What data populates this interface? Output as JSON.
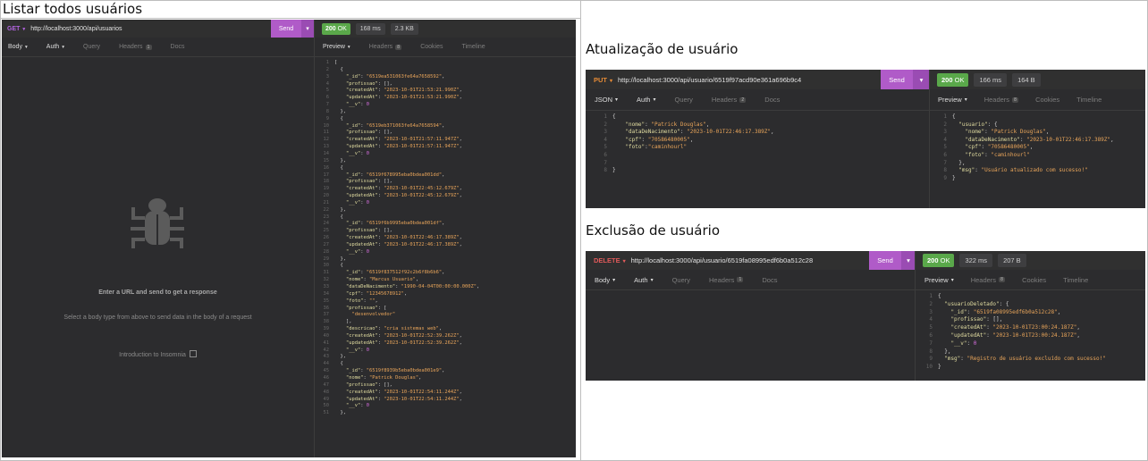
{
  "section_titles": {
    "list": "Listar todos usuários",
    "update": "Atualização de usuário",
    "delete": "Exclusão de usuário"
  },
  "list_panel": {
    "method": "GET",
    "url": "http://localhost:3000/api/usuarios",
    "send_label": "Send",
    "status_code": "200",
    "status_text": "OK",
    "time": "168 ms",
    "size": "2.3 KB",
    "request_tabs": [
      {
        "label": "Body",
        "caret": true,
        "active": true
      },
      {
        "label": "Auth",
        "caret": true,
        "active": false
      },
      {
        "label": "Query",
        "caret": false,
        "active": false
      },
      {
        "label": "Headers",
        "badge": "1",
        "active": false
      },
      {
        "label": "Docs",
        "active": false
      }
    ],
    "response_tabs": [
      {
        "label": "Preview",
        "caret": true,
        "active": true
      },
      {
        "label": "Headers",
        "badge": "8",
        "active": false
      },
      {
        "label": "Cookies",
        "active": false
      },
      {
        "label": "Timeline",
        "active": false
      }
    ],
    "empty_title": "Enter a URL and send to get a response",
    "empty_subtitle": "Select a body type from above to send data in the body of a request",
    "empty_link": "Introduction to Insomnia",
    "response_lines": [
      [
        {
          "t": "[",
          "c": "p"
        }
      ],
      [
        {
          "t": "  {",
          "c": "p"
        }
      ],
      [
        {
          "t": "    \"_id\"",
          "c": "k"
        },
        {
          "t": ": ",
          "c": "p"
        },
        {
          "t": "\"6519ea531063fe64a7658592\"",
          "c": "s"
        },
        {
          "t": ",",
          "c": "p"
        }
      ],
      [
        {
          "t": "    \"profissao\"",
          "c": "k"
        },
        {
          "t": ": [],",
          "c": "p"
        }
      ],
      [
        {
          "t": "    \"createdAt\"",
          "c": "k"
        },
        {
          "t": ": ",
          "c": "p"
        },
        {
          "t": "\"2023-10-01T21:53:21.990Z\"",
          "c": "s"
        },
        {
          "t": ",",
          "c": "p"
        }
      ],
      [
        {
          "t": "    \"updatedAt\"",
          "c": "k"
        },
        {
          "t": ": ",
          "c": "p"
        },
        {
          "t": "\"2023-10-01T21:53:21.990Z\"",
          "c": "s"
        },
        {
          "t": ",",
          "c": "p"
        }
      ],
      [
        {
          "t": "    \"__v\"",
          "c": "k"
        },
        {
          "t": ": ",
          "c": "p"
        },
        {
          "t": "0",
          "c": "n"
        }
      ],
      [
        {
          "t": "  },",
          "c": "p"
        }
      ],
      [
        {
          "t": "  {",
          "c": "p"
        }
      ],
      [
        {
          "t": "    \"_id\"",
          "c": "k"
        },
        {
          "t": ": ",
          "c": "p"
        },
        {
          "t": "\"6519eb371063fe64a7658594\"",
          "c": "s"
        },
        {
          "t": ",",
          "c": "p"
        }
      ],
      [
        {
          "t": "    \"profissao\"",
          "c": "k"
        },
        {
          "t": ": [],",
          "c": "p"
        }
      ],
      [
        {
          "t": "    \"createdAt\"",
          "c": "k"
        },
        {
          "t": ": ",
          "c": "p"
        },
        {
          "t": "\"2023-10-01T21:57:11.947Z\"",
          "c": "s"
        },
        {
          "t": ",",
          "c": "p"
        }
      ],
      [
        {
          "t": "    \"updatedAt\"",
          "c": "k"
        },
        {
          "t": ": ",
          "c": "p"
        },
        {
          "t": "\"2023-10-01T21:57:11.947Z\"",
          "c": "s"
        },
        {
          "t": ",",
          "c": "p"
        }
      ],
      [
        {
          "t": "    \"__v\"",
          "c": "k"
        },
        {
          "t": ": ",
          "c": "p"
        },
        {
          "t": "0",
          "c": "n"
        }
      ],
      [
        {
          "t": "  },",
          "c": "p"
        }
      ],
      [
        {
          "t": "  {",
          "c": "p"
        }
      ],
      [
        {
          "t": "    \"_id\"",
          "c": "k"
        },
        {
          "t": ": ",
          "c": "p"
        },
        {
          "t": "\"6519f678995eba0bdea001dd\"",
          "c": "s"
        },
        {
          "t": ",",
          "c": "p"
        }
      ],
      [
        {
          "t": "    \"profissao\"",
          "c": "k"
        },
        {
          "t": ": [],",
          "c": "p"
        }
      ],
      [
        {
          "t": "    \"createdAt\"",
          "c": "k"
        },
        {
          "t": ": ",
          "c": "p"
        },
        {
          "t": "\"2023-10-01T22:45:12.679Z\"",
          "c": "s"
        },
        {
          "t": ",",
          "c": "p"
        }
      ],
      [
        {
          "t": "    \"updatedAt\"",
          "c": "k"
        },
        {
          "t": ": ",
          "c": "p"
        },
        {
          "t": "\"2023-10-01T22:45:12.679Z\"",
          "c": "s"
        },
        {
          "t": ",",
          "c": "p"
        }
      ],
      [
        {
          "t": "    \"__v\"",
          "c": "k"
        },
        {
          "t": ": ",
          "c": "p"
        },
        {
          "t": "0",
          "c": "n"
        }
      ],
      [
        {
          "t": "  },",
          "c": "p"
        }
      ],
      [
        {
          "t": "  {",
          "c": "p"
        }
      ],
      [
        {
          "t": "    \"_id\"",
          "c": "k"
        },
        {
          "t": ": ",
          "c": "p"
        },
        {
          "t": "\"6519f6b9995eba0bdea001df\"",
          "c": "s"
        },
        {
          "t": ",",
          "c": "p"
        }
      ],
      [
        {
          "t": "    \"profissao\"",
          "c": "k"
        },
        {
          "t": ": [],",
          "c": "p"
        }
      ],
      [
        {
          "t": "    \"createdAt\"",
          "c": "k"
        },
        {
          "t": ": ",
          "c": "p"
        },
        {
          "t": "\"2023-10-01T22:46:17.389Z\"",
          "c": "s"
        },
        {
          "t": ",",
          "c": "p"
        }
      ],
      [
        {
          "t": "    \"updatedAt\"",
          "c": "k"
        },
        {
          "t": ": ",
          "c": "p"
        },
        {
          "t": "\"2023-10-01T22:46:17.389Z\"",
          "c": "s"
        },
        {
          "t": ",",
          "c": "p"
        }
      ],
      [
        {
          "t": "    \"__v\"",
          "c": "k"
        },
        {
          "t": ": ",
          "c": "p"
        },
        {
          "t": "0",
          "c": "n"
        }
      ],
      [
        {
          "t": "  },",
          "c": "p"
        }
      ],
      [
        {
          "t": "  {",
          "c": "p"
        }
      ],
      [
        {
          "t": "    \"_id\"",
          "c": "k"
        },
        {
          "t": ": ",
          "c": "p"
        },
        {
          "t": "\"6519f837512f92c2b6f8b6b6\"",
          "c": "s"
        },
        {
          "t": ",",
          "c": "p"
        }
      ],
      [
        {
          "t": "    \"nome\"",
          "c": "k"
        },
        {
          "t": ": ",
          "c": "p"
        },
        {
          "t": "\"Marcus Usuario\"",
          "c": "s"
        },
        {
          "t": ",",
          "c": "p"
        }
      ],
      [
        {
          "t": "    \"dataDeNacimento\"",
          "c": "k"
        },
        {
          "t": ": ",
          "c": "p"
        },
        {
          "t": "\"1990-04-04T00:00:00.000Z\"",
          "c": "s"
        },
        {
          "t": ",",
          "c": "p"
        }
      ],
      [
        {
          "t": "    \"cpf\"",
          "c": "k"
        },
        {
          "t": ": ",
          "c": "p"
        },
        {
          "t": "\"12345678912\"",
          "c": "s"
        },
        {
          "t": ",",
          "c": "p"
        }
      ],
      [
        {
          "t": "    \"foto\"",
          "c": "k"
        },
        {
          "t": ": ",
          "c": "p"
        },
        {
          "t": "\"\"",
          "c": "s"
        },
        {
          "t": ",",
          "c": "p"
        }
      ],
      [
        {
          "t": "    \"profissao\"",
          "c": "k"
        },
        {
          "t": ": [",
          "c": "p"
        }
      ],
      [
        {
          "t": "      \"desenvolvedor\"",
          "c": "s"
        }
      ],
      [
        {
          "t": "    ],",
          "c": "p"
        }
      ],
      [
        {
          "t": "    \"descricao\"",
          "c": "k"
        },
        {
          "t": ": ",
          "c": "p"
        },
        {
          "t": "\"cria sistemas web\"",
          "c": "s"
        },
        {
          "t": ",",
          "c": "p"
        }
      ],
      [
        {
          "t": "    \"createdAt\"",
          "c": "k"
        },
        {
          "t": ": ",
          "c": "p"
        },
        {
          "t": "\"2023-10-01T22:52:39.262Z\"",
          "c": "s"
        },
        {
          "t": ",",
          "c": "p"
        }
      ],
      [
        {
          "t": "    \"updatedAt\"",
          "c": "k"
        },
        {
          "t": ": ",
          "c": "p"
        },
        {
          "t": "\"2023-10-01T22:52:39.262Z\"",
          "c": "s"
        },
        {
          "t": ",",
          "c": "p"
        }
      ],
      [
        {
          "t": "    \"__v\"",
          "c": "k"
        },
        {
          "t": ": ",
          "c": "p"
        },
        {
          "t": "0",
          "c": "n"
        }
      ],
      [
        {
          "t": "  },",
          "c": "p"
        }
      ],
      [
        {
          "t": "  {",
          "c": "p"
        }
      ],
      [
        {
          "t": "    \"_id\"",
          "c": "k"
        },
        {
          "t": ": ",
          "c": "p"
        },
        {
          "t": "\"6519f8939b5eba0bdea001e9\"",
          "c": "s"
        },
        {
          "t": ",",
          "c": "p"
        }
      ],
      [
        {
          "t": "    \"nome\"",
          "c": "k"
        },
        {
          "t": ": ",
          "c": "p"
        },
        {
          "t": "\"Patrick Douglas\"",
          "c": "s"
        },
        {
          "t": ",",
          "c": "p"
        }
      ],
      [
        {
          "t": "    \"profissao\"",
          "c": "k"
        },
        {
          "t": ": [],",
          "c": "p"
        }
      ],
      [
        {
          "t": "    \"createdAt\"",
          "c": "k"
        },
        {
          "t": ": ",
          "c": "p"
        },
        {
          "t": "\"2023-10-01T22:54:11.244Z\"",
          "c": "s"
        },
        {
          "t": ",",
          "c": "p"
        }
      ],
      [
        {
          "t": "    \"updatedAt\"",
          "c": "k"
        },
        {
          "t": ": ",
          "c": "p"
        },
        {
          "t": "\"2023-10-01T22:54:11.244Z\"",
          "c": "s"
        },
        {
          "t": ",",
          "c": "p"
        }
      ],
      [
        {
          "t": "    \"__v\"",
          "c": "k"
        },
        {
          "t": ": ",
          "c": "p"
        },
        {
          "t": "0",
          "c": "n"
        }
      ],
      [
        {
          "t": "  },",
          "c": "p"
        }
      ]
    ]
  },
  "update_panel": {
    "method": "PUT",
    "url": "http://localhost:3000/api/usuario/6519f97acd90e361a696b9c4",
    "send_label": "Send",
    "status_code": "200",
    "status_text": "OK",
    "time": "166 ms",
    "size": "164 B",
    "request_tabs": [
      {
        "label": "JSON",
        "caret": true,
        "active": true
      },
      {
        "label": "Auth",
        "caret": true,
        "active": false
      },
      {
        "label": "Query",
        "active": false
      },
      {
        "label": "Headers",
        "badge": "2",
        "active": false
      },
      {
        "label": "Docs",
        "active": false
      }
    ],
    "response_tabs": [
      {
        "label": "Preview",
        "caret": true,
        "active": true
      },
      {
        "label": "Headers",
        "badge": "8",
        "active": false
      },
      {
        "label": "Cookies",
        "active": false
      },
      {
        "label": "Timeline",
        "active": false
      }
    ],
    "request_lines": [
      [
        {
          "t": "{",
          "c": "p"
        }
      ],
      [
        {
          "t": "    \"nome\"",
          "c": "k"
        },
        {
          "t": ": ",
          "c": "p"
        },
        {
          "t": "\"Patrick Douglas\"",
          "c": "s"
        },
        {
          "t": ",",
          "c": "p"
        }
      ],
      [
        {
          "t": "    \"dataDeNacimento\"",
          "c": "k"
        },
        {
          "t": ": ",
          "c": "p"
        },
        {
          "t": "\"2023-10-01T22:46:17.389Z\"",
          "c": "s"
        },
        {
          "t": ",",
          "c": "p"
        }
      ],
      [
        {
          "t": "    \"cpf\"",
          "c": "k"
        },
        {
          "t": ": ",
          "c": "p"
        },
        {
          "t": "\"70586480005\"",
          "c": "s"
        },
        {
          "t": ",",
          "c": "p"
        }
      ],
      [
        {
          "t": "    \"foto\"",
          "c": "k"
        },
        {
          "t": ":",
          "c": "p"
        },
        {
          "t": "\"caminhourl\"",
          "c": "s"
        }
      ],
      [
        {
          "t": "",
          "c": "p"
        }
      ],
      [
        {
          "t": "",
          "c": "p"
        }
      ],
      [
        {
          "t": "}",
          "c": "p"
        }
      ]
    ],
    "response_lines": [
      [
        {
          "t": "{",
          "c": "p"
        }
      ],
      [
        {
          "t": "  \"usuario\"",
          "c": "k"
        },
        {
          "t": ": {",
          "c": "p"
        }
      ],
      [
        {
          "t": "    \"nome\"",
          "c": "k"
        },
        {
          "t": ": ",
          "c": "p"
        },
        {
          "t": "\"Patrick Douglas\"",
          "c": "s"
        },
        {
          "t": ",",
          "c": "p"
        }
      ],
      [
        {
          "t": "    \"dataDeNacimento\"",
          "c": "k"
        },
        {
          "t": ": ",
          "c": "p"
        },
        {
          "t": "\"2023-10-01T22:46:17.389Z\"",
          "c": "s"
        },
        {
          "t": ",",
          "c": "p"
        }
      ],
      [
        {
          "t": "    \"cpf\"",
          "c": "k"
        },
        {
          "t": ": ",
          "c": "p"
        },
        {
          "t": "\"70586480005\"",
          "c": "s"
        },
        {
          "t": ",",
          "c": "p"
        }
      ],
      [
        {
          "t": "    \"foto\"",
          "c": "k"
        },
        {
          "t": ": ",
          "c": "p"
        },
        {
          "t": "\"caminhourl\"",
          "c": "s"
        }
      ],
      [
        {
          "t": "  },",
          "c": "p"
        }
      ],
      [
        {
          "t": "  \"msg\"",
          "c": "k"
        },
        {
          "t": ": ",
          "c": "p"
        },
        {
          "t": "\"Usuário atualizado com sucesso!\"",
          "c": "s"
        }
      ],
      [
        {
          "t": "}",
          "c": "p"
        }
      ]
    ]
  },
  "delete_panel": {
    "method": "DELETE",
    "url": "http://localhost:3000/api/usuario/6519fa08995edf6b0a512c28",
    "send_label": "Send",
    "status_code": "200",
    "status_text": "OK",
    "time": "322 ms",
    "size": "207 B",
    "request_tabs": [
      {
        "label": "Body",
        "caret": true,
        "active": true
      },
      {
        "label": "Auth",
        "caret": true,
        "active": false
      },
      {
        "label": "Query",
        "active": false
      },
      {
        "label": "Headers",
        "badge": "1",
        "active": false
      },
      {
        "label": "Docs",
        "active": false
      }
    ],
    "response_tabs": [
      {
        "label": "Preview",
        "caret": true,
        "active": true
      },
      {
        "label": "Headers",
        "badge": "8",
        "active": false
      },
      {
        "label": "Cookies",
        "active": false
      },
      {
        "label": "Timeline",
        "active": false
      }
    ],
    "response_lines": [
      [
        {
          "t": "{",
          "c": "p"
        }
      ],
      [
        {
          "t": "  \"usuarioDeletado\"",
          "c": "k"
        },
        {
          "t": ": {",
          "c": "p"
        }
      ],
      [
        {
          "t": "    \"_id\"",
          "c": "k"
        },
        {
          "t": ": ",
          "c": "p"
        },
        {
          "t": "\"6519fa08995edf6b0a512c28\"",
          "c": "s"
        },
        {
          "t": ",",
          "c": "p"
        }
      ],
      [
        {
          "t": "    \"profissao\"",
          "c": "k"
        },
        {
          "t": ": [],",
          "c": "p"
        }
      ],
      [
        {
          "t": "    \"createdAt\"",
          "c": "k"
        },
        {
          "t": ": ",
          "c": "p"
        },
        {
          "t": "\"2023-10-01T23:00:24.187Z\"",
          "c": "s"
        },
        {
          "t": ",",
          "c": "p"
        }
      ],
      [
        {
          "t": "    \"updatedAt\"",
          "c": "k"
        },
        {
          "t": ": ",
          "c": "p"
        },
        {
          "t": "\"2023-10-01T23:00:24.187Z\"",
          "c": "s"
        },
        {
          "t": ",",
          "c": "p"
        }
      ],
      [
        {
          "t": "    \"__v\"",
          "c": "k"
        },
        {
          "t": ": ",
          "c": "p"
        },
        {
          "t": "0",
          "c": "n"
        }
      ],
      [
        {
          "t": "  },",
          "c": "p"
        }
      ],
      [
        {
          "t": "  \"msg\"",
          "c": "k"
        },
        {
          "t": ": ",
          "c": "p"
        },
        {
          "t": "\"Registro de usuário excluído com sucesso!\"",
          "c": "s"
        }
      ],
      [
        {
          "t": "}",
          "c": "p"
        }
      ]
    ]
  },
  "colors": {
    "get": "#b264e0",
    "put": "#e78b36",
    "delete": "#e05a5a",
    "send": "#b05bc8",
    "status_ok": "#5aa84a"
  },
  "icons": {
    "empty_state": "bug-icon",
    "external_link": "external-link-icon",
    "dropdown": "chevron-down-icon"
  }
}
